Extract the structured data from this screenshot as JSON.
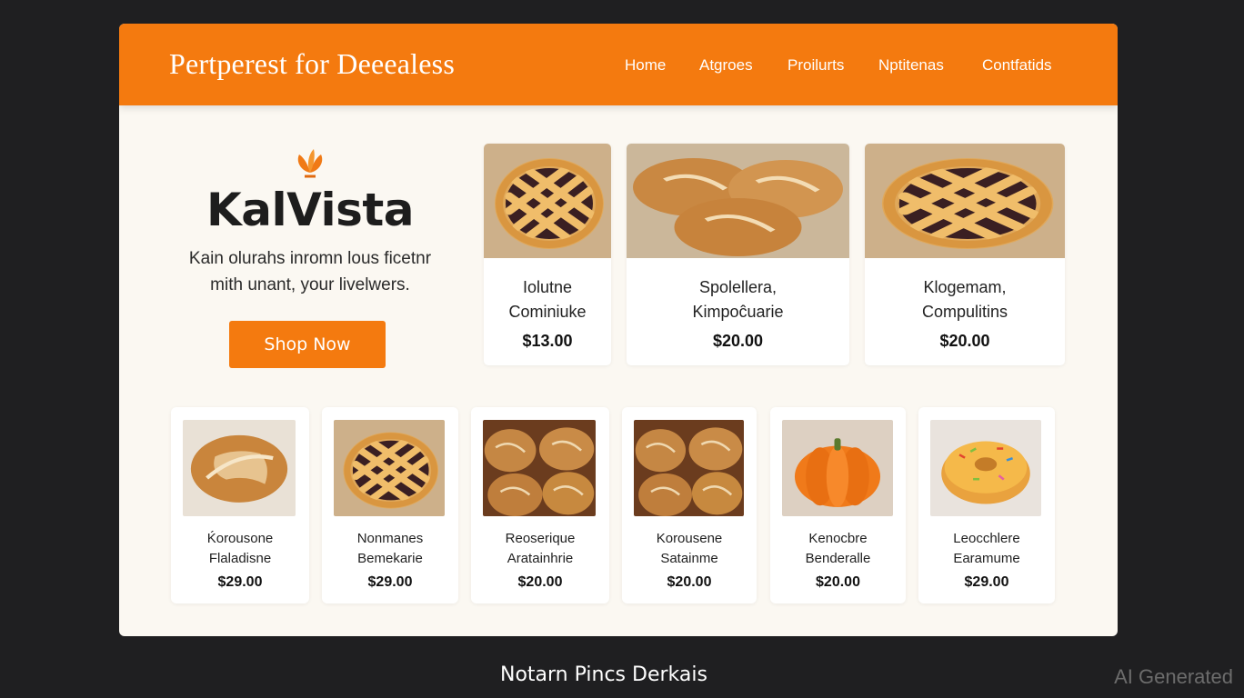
{
  "header": {
    "title": "Pertperest for Deeealess",
    "nav": [
      "Home",
      "Atgroes",
      "Proilurts",
      "Nptitenas",
      "Contfatids"
    ]
  },
  "hero": {
    "brand": "KalVista",
    "tagline": [
      "Kain olurahs inromn lous ficetnr",
      "mith unant, your livelwers."
    ],
    "cta": "Shop Now"
  },
  "featured": [
    {
      "name": [
        "Iolutne",
        "Cominiuke"
      ],
      "price": "$13.00",
      "image": "lattice-pie"
    },
    {
      "name": [
        "Spolellera,",
        "Kimpoĉuarie"
      ],
      "price": "$20.00",
      "image": "bread-loaves"
    },
    {
      "name": [
        "Klogemam,",
        "Compulitins"
      ],
      "price": "$20.00",
      "image": "lattice-pie"
    }
  ],
  "products": [
    {
      "name": [
        "Ḱorousone",
        "Flaladisne"
      ],
      "price": "$29.00",
      "image": "bread-loaf"
    },
    {
      "name": [
        "Nonmanes",
        "Bemekarie"
      ],
      "price": "$29.00",
      "image": "lattice-pie"
    },
    {
      "name": [
        "Reoserique",
        "Aratainhrie"
      ],
      "price": "$20.00",
      "image": "bread-rolls"
    },
    {
      "name": [
        "Korousene",
        "Satainme"
      ],
      "price": "$20.00",
      "image": "bread-rolls"
    },
    {
      "name": [
        "Kenocbre",
        "Benderalle"
      ],
      "price": "$20.00",
      "image": "pumpkin"
    },
    {
      "name": [
        "Leocchlere",
        "Earamume"
      ],
      "price": "$29.00",
      "image": "donut"
    }
  ],
  "footer": "Notarn Pincs  Derkais",
  "watermark": "AI Generated",
  "colors": {
    "accent": "#f47a0f",
    "panel": "#fbf8f2",
    "page": "#1f1f21"
  }
}
